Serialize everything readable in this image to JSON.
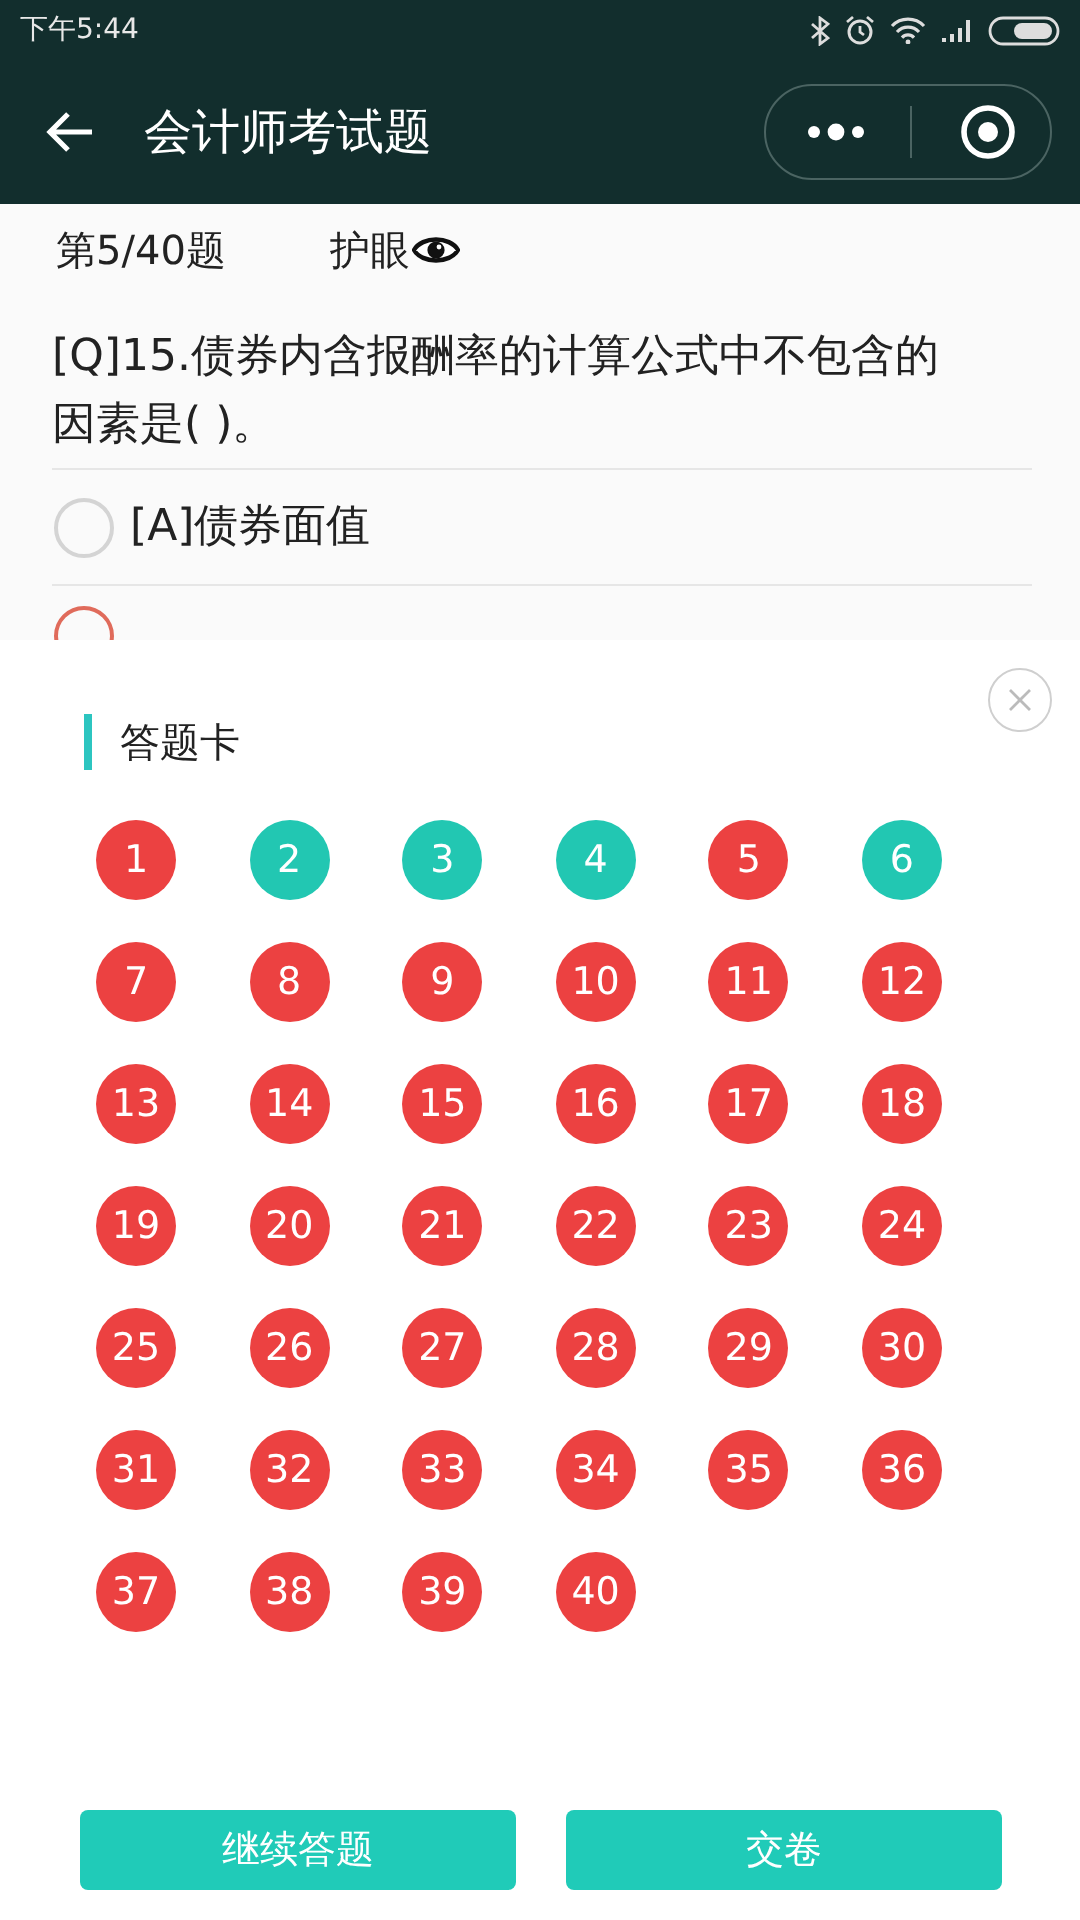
{
  "status_bar": {
    "time": "下午5:44"
  },
  "nav": {
    "title": "会计师考试题"
  },
  "header": {
    "progress": "第5/40题",
    "eye_mode": "护眼"
  },
  "question": {
    "text": "[Q]15.债券内含报酬率的计算公式中不包含的因素是(    )。",
    "options": [
      {
        "label": "[A]债券面值",
        "selected": false
      }
    ],
    "partial_option": {
      "color": "#e06b5b"
    }
  },
  "answer_card": {
    "title": "答题卡",
    "items": [
      {
        "number": "1",
        "color": "#ec4141"
      },
      {
        "number": "2",
        "color": "#22c7b2"
      },
      {
        "number": "3",
        "color": "#22c7b2"
      },
      {
        "number": "4",
        "color": "#22c7b2"
      },
      {
        "number": "5",
        "color": "#ec4141"
      },
      {
        "number": "6",
        "color": "#22c7b2"
      },
      {
        "number": "7",
        "color": "#ec4141"
      },
      {
        "number": "8",
        "color": "#ec4141"
      },
      {
        "number": "9",
        "color": "#ec4141"
      },
      {
        "number": "10",
        "color": "#ec4141"
      },
      {
        "number": "11",
        "color": "#ec4141"
      },
      {
        "number": "12",
        "color": "#ec4141"
      },
      {
        "number": "13",
        "color": "#ec4141"
      },
      {
        "number": "14",
        "color": "#ec4141"
      },
      {
        "number": "15",
        "color": "#ec4141"
      },
      {
        "number": "16",
        "color": "#ec4141"
      },
      {
        "number": "17",
        "color": "#ec4141"
      },
      {
        "number": "18",
        "color": "#ec4141"
      },
      {
        "number": "19",
        "color": "#ec4141"
      },
      {
        "number": "20",
        "color": "#ec4141"
      },
      {
        "number": "21",
        "color": "#ec4141"
      },
      {
        "number": "22",
        "color": "#ec4141"
      },
      {
        "number": "23",
        "color": "#ec4141"
      },
      {
        "number": "24",
        "color": "#ec4141"
      },
      {
        "number": "25",
        "color": "#ec4141"
      },
      {
        "number": "26",
        "color": "#ec4141"
      },
      {
        "number": "27",
        "color": "#ec4141"
      },
      {
        "number": "28",
        "color": "#ec4141"
      },
      {
        "number": "29",
        "color": "#ec4141"
      },
      {
        "number": "30",
        "color": "#ec4141"
      },
      {
        "number": "31",
        "color": "#ec4141"
      },
      {
        "number": "32",
        "color": "#ec4141"
      },
      {
        "number": "33",
        "color": "#ec4141"
      },
      {
        "number": "34",
        "color": "#ec4141"
      },
      {
        "number": "35",
        "color": "#ec4141"
      },
      {
        "number": "36",
        "color": "#ec4141"
      },
      {
        "number": "37",
        "color": "#ec4141"
      },
      {
        "number": "38",
        "color": "#ec4141"
      },
      {
        "number": "39",
        "color": "#ec4141"
      },
      {
        "number": "40",
        "color": "#ec4141"
      }
    ],
    "buttons": [
      "继续答题",
      "交卷"
    ]
  }
}
